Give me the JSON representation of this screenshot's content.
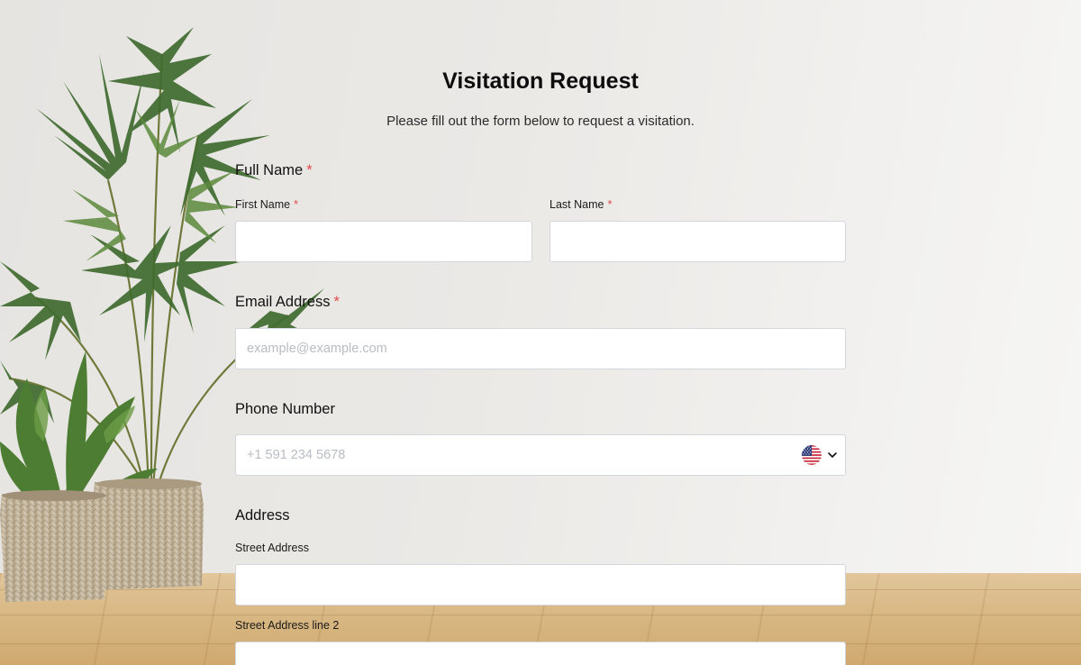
{
  "form": {
    "title": "Visitation Request",
    "subtitle": "Please fill out the form below to request a visitation.",
    "full_name": {
      "label": "Full Name",
      "required_mark": "*",
      "first_name_label": "First Name",
      "first_name_value": "",
      "last_name_label": "Last Name",
      "last_name_value": ""
    },
    "email": {
      "label": "Email Address",
      "required_mark": "*",
      "placeholder": "example@example.com",
      "value": ""
    },
    "phone": {
      "label": "Phone Number",
      "placeholder": "+1 591 234 5678",
      "value": "",
      "country_icon": "us-flag-icon"
    },
    "address": {
      "label": "Address",
      "street_label": "Street Address",
      "street_value": "",
      "street2_label": "Street Address line 2",
      "street2_value": ""
    }
  },
  "colors": {
    "required": "#e04a4a",
    "field_border": "#d3d6dc",
    "placeholder": "#b9bcc2"
  }
}
